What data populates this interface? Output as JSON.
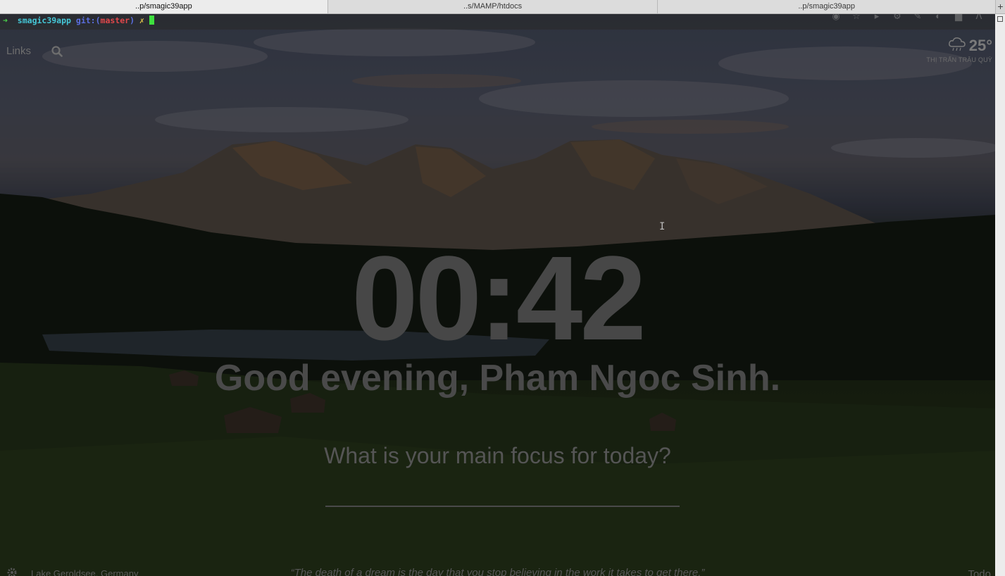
{
  "tabs": [
    {
      "label": "..p/smagic39app",
      "active": true
    },
    {
      "label": "..s/MAMP/htdocs",
      "active": false
    },
    {
      "label": "..p/smagic39app",
      "active": false
    }
  ],
  "tab_add_label": "+",
  "terminal": {
    "arrow": "➜",
    "directory": "smagic39app",
    "git_prefix": "git:(",
    "branch": "master",
    "git_suffix": ")",
    "dirty_mark": "✗"
  },
  "dashboard": {
    "links_label": "Links",
    "weather": {
      "temperature": "25°",
      "location": "THỊ TRẤN TRÂU QUỲ",
      "icon": "rain-cloud-icon"
    },
    "clock": "00:42",
    "greeting": "Good evening, Pham Ngoc Sinh.",
    "focus_question": "What is your main focus for today?",
    "focus_input_value": "",
    "photo_location": "Lake Geroldsee, Germany",
    "quote": "“The death of a dream is the day that you stop believing in the work it takes to get there.”",
    "todo_label": "Todo"
  },
  "colors": {
    "prompt_arrow": "#4ad04a",
    "prompt_dir": "#45c7d6",
    "prompt_branch": "#e0474a",
    "cursor": "#3ee03e"
  }
}
